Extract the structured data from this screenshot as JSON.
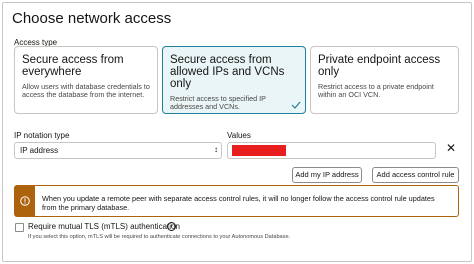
{
  "title": "Choose network access",
  "access_type": {
    "label": "Access type",
    "options": [
      {
        "title": "Secure access from everywhere",
        "description": "Allow users with database credentials to access the database from the internet.",
        "selected": false
      },
      {
        "title": "Secure access from allowed IPs and VCNs only",
        "description": "Restrict access to specified IP addresses and VCNs.",
        "selected": true
      },
      {
        "title": "Private endpoint access only",
        "description": "Restrict access to a private endpoint within an OCI VCN.",
        "selected": false
      }
    ]
  },
  "ip_notation": {
    "label": "IP notation type",
    "value": "IP address"
  },
  "values": {
    "label": "Values"
  },
  "buttons": {
    "add_my_ip": "Add my IP address",
    "add_rule": "Add access control rule"
  },
  "warning": {
    "icon": "exclamation-icon",
    "text": "When you update a remote peer with separate access control rules, it will no longer follow the access control rule updates from the primary database."
  },
  "mtls": {
    "label": "Require mutual TLS (mTLS) authentication",
    "checked": false,
    "help": "If you select this option, mTLS will be required to authenticate connections to your Autonomous Database."
  },
  "colors": {
    "accent": "#227e9e",
    "selected_bg": "#eaf5f7",
    "warning": "#ac630c",
    "redaction": "#e81e1e"
  }
}
